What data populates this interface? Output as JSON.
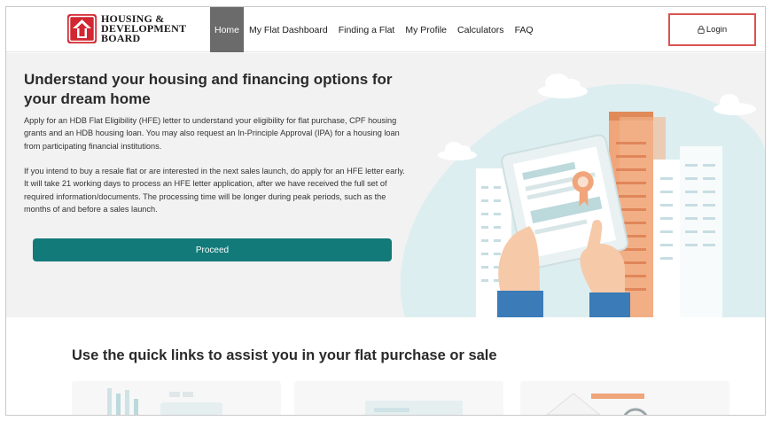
{
  "brand": {
    "logo_lines": [
      "HOUSING &",
      "DEVELOPMENT",
      "BOARD"
    ],
    "logo_color": "#d22630"
  },
  "nav": {
    "items": [
      {
        "label": "Home",
        "active": true
      },
      {
        "label": "My Flat Dashboard",
        "active": false
      },
      {
        "label": "Finding a Flat",
        "active": false
      },
      {
        "label": "My Profile",
        "active": false
      },
      {
        "label": "Calculators",
        "active": false
      },
      {
        "label": "FAQ",
        "active": false
      }
    ]
  },
  "login": {
    "label": "Login",
    "icon": "lock-icon",
    "highlight_color": "#d9534f"
  },
  "hero": {
    "title": "Understand your housing and financing options for your dream home",
    "paragraph1": "Apply for an HDB Flat Eligibility (HFE) letter to understand your eligibility for flat purchase, CPF housing grants and an HDB housing loan. You may also request an In-Principle Approval (IPA) for a housing loan from participating financial institutions.",
    "paragraph2": "If you intend to buy a resale flat or are interested in the next sales launch, do apply for an HFE letter early. It will take 21 working days to process an HFE letter application, after we have received the full set of required information/documents. The processing time will be longer during peak periods, such as the months of and before a sales launch.",
    "proceed_label": "Proceed",
    "accent_color": "#127a79"
  },
  "quick_links": {
    "title": "Use the quick links to assist you in your flat purchase or sale"
  }
}
